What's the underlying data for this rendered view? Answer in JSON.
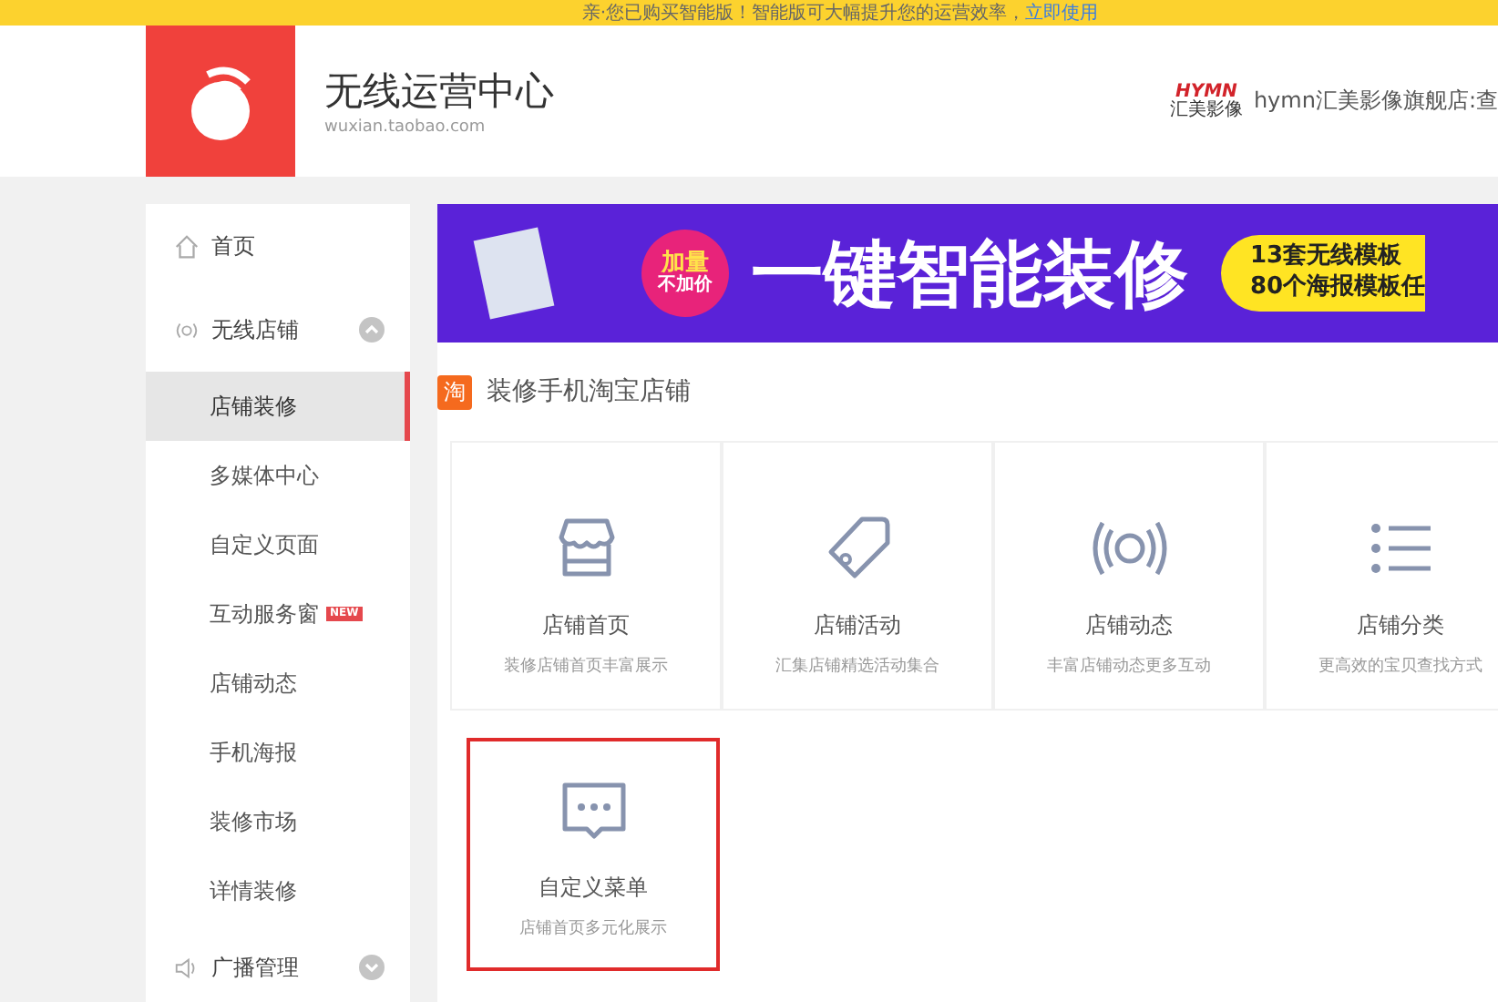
{
  "notice": {
    "text": "亲·您已购买智能版！智能版可大幅提升您的运营效率，",
    "link": "立即使用"
  },
  "header": {
    "title": "无线运营中心",
    "subtitle": "wuxian.taobao.com",
    "store_logo_top": "HYMN",
    "store_logo_bottom": "汇美影像",
    "store_name": "hymn汇美影像旗舰店:查"
  },
  "sidebar": [
    {
      "label": "首页",
      "kind": "home"
    },
    {
      "label": "无线店铺",
      "kind": "shop",
      "expanded": true,
      "children": [
        {
          "label": "店铺装修",
          "selected": true
        },
        {
          "label": "多媒体中心",
          "selected": false
        },
        {
          "label": "自定义页面",
          "selected": false
        },
        {
          "label": "互动服务窗",
          "selected": false,
          "badge": "NEW"
        },
        {
          "label": "店铺动态",
          "selected": false
        },
        {
          "label": "手机海报",
          "selected": false
        },
        {
          "label": "装修市场",
          "selected": false
        },
        {
          "label": "详情装修",
          "selected": false
        }
      ]
    },
    {
      "label": "广播管理",
      "kind": "broadcast",
      "expanded": false
    }
  ],
  "banner": {
    "badge_top": "加量",
    "badge_bottom": "不加价",
    "headline": "一键智能装修",
    "line_1": "13套无线模板",
    "line_2": "80个海报模板任"
  },
  "section": {
    "icon": "淘",
    "title": "装修手机淘宝店铺"
  },
  "cards": [
    {
      "kind": "store",
      "title": "店铺首页",
      "desc": "装修店铺首页丰富展示",
      "selected": false
    },
    {
      "kind": "tag",
      "title": "店铺活动",
      "desc": "汇集店铺精选活动集合",
      "selected": false
    },
    {
      "kind": "broadcast",
      "title": "店铺动态",
      "desc": "丰富店铺动态更多互动",
      "selected": false
    },
    {
      "kind": "list",
      "title": "店铺分类",
      "desc": "更高效的宝贝查找方式",
      "selected": false
    },
    {
      "kind": "chat",
      "title": "自定义菜单",
      "desc": "店铺首页多元化展示",
      "selected": true
    }
  ]
}
